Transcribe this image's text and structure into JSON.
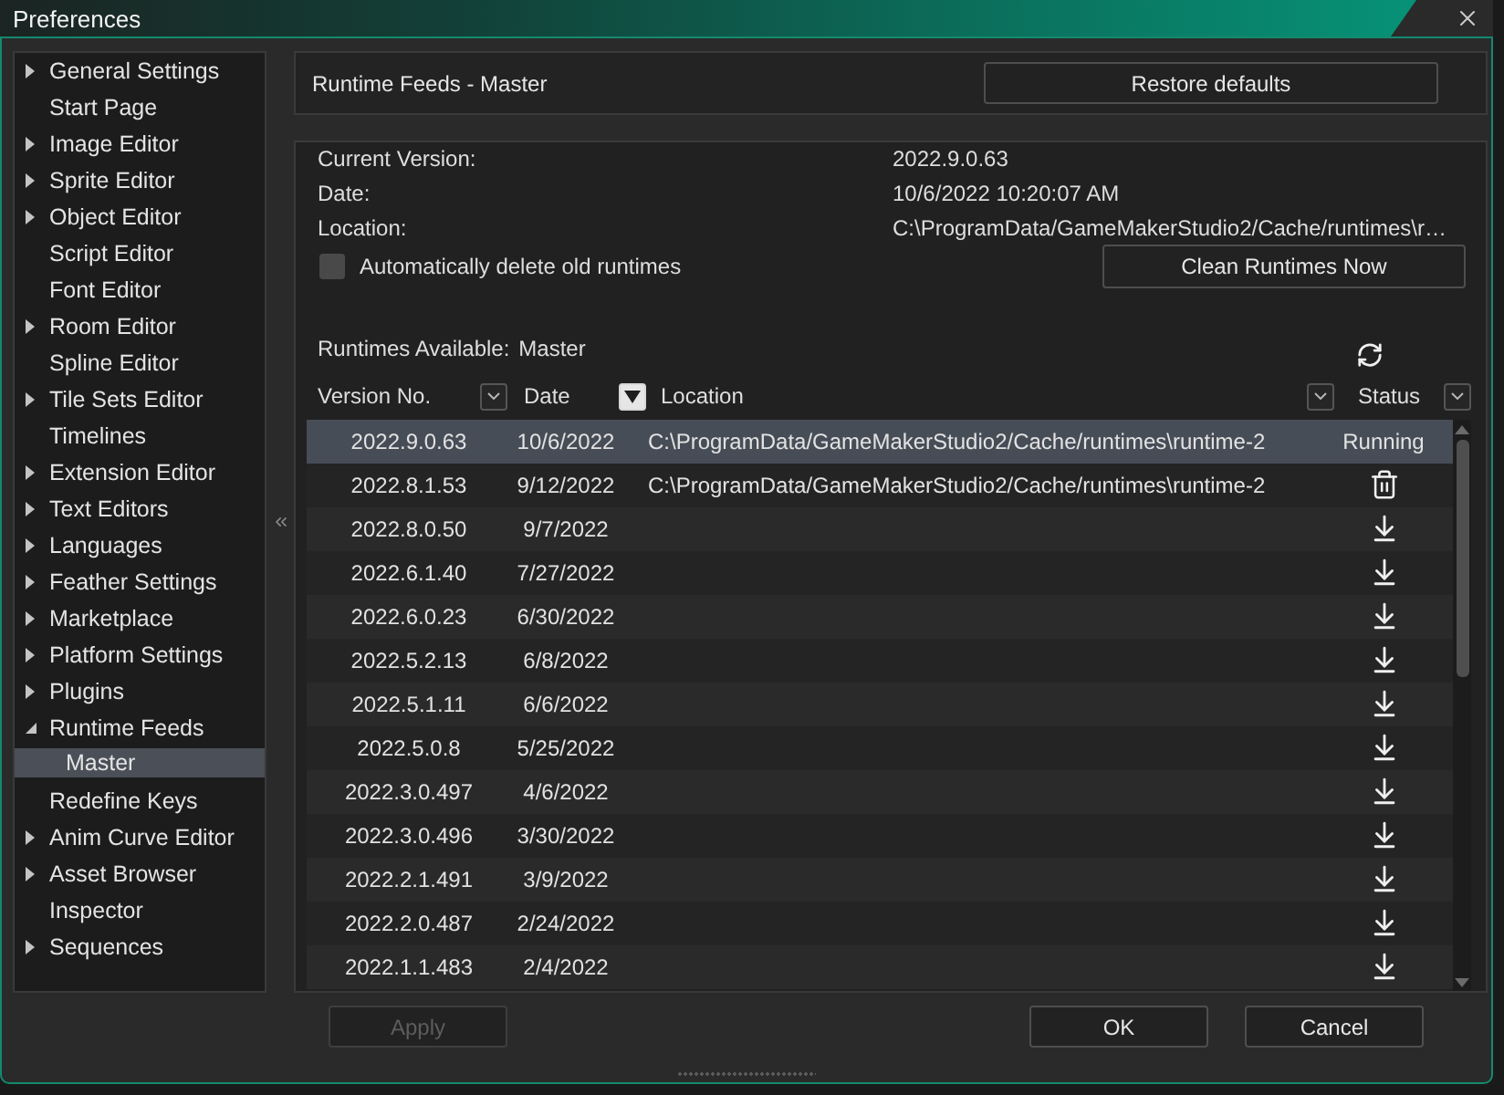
{
  "window": {
    "title": "Preferences"
  },
  "sidebar": {
    "items": [
      {
        "label": "General Settings",
        "expanded": false,
        "selected": false
      },
      {
        "label": "Start Page",
        "selected": false
      },
      {
        "label": "Image Editor",
        "expanded": false,
        "selected": false
      },
      {
        "label": "Sprite Editor",
        "expanded": false,
        "selected": false
      },
      {
        "label": "Object Editor",
        "expanded": false,
        "selected": false
      },
      {
        "label": "Script Editor",
        "selected": false
      },
      {
        "label": "Font Editor",
        "selected": false
      },
      {
        "label": "Room Editor",
        "expanded": false,
        "selected": false
      },
      {
        "label": "Spline Editor",
        "selected": false
      },
      {
        "label": "Tile Sets Editor",
        "expanded": false,
        "selected": false
      },
      {
        "label": "Timelines",
        "selected": false
      },
      {
        "label": "Extension Editor",
        "expanded": false,
        "selected": false
      },
      {
        "label": "Text Editors",
        "expanded": false,
        "selected": false
      },
      {
        "label": "Languages",
        "expanded": false,
        "selected": false
      },
      {
        "label": "Feather Settings",
        "expanded": false,
        "selected": false
      },
      {
        "label": "Marketplace",
        "expanded": false,
        "selected": false
      },
      {
        "label": "Platform Settings",
        "expanded": false,
        "selected": false
      },
      {
        "label": "Plugins",
        "expanded": false,
        "selected": false
      },
      {
        "label": "Runtime Feeds",
        "expanded": true,
        "selected": false,
        "children": [
          {
            "label": "Master",
            "selected": true
          }
        ]
      },
      {
        "label": "Redefine Keys",
        "selected": false
      },
      {
        "label": "Anim Curve Editor",
        "expanded": false,
        "selected": false
      },
      {
        "label": "Asset Browser",
        "expanded": false,
        "selected": false
      },
      {
        "label": "Inspector",
        "selected": false
      },
      {
        "label": "Sequences",
        "expanded": false,
        "selected": false
      }
    ]
  },
  "header": {
    "title": "Runtime Feeds - Master",
    "button": "Restore defaults"
  },
  "info": {
    "fields": [
      {
        "label": "Current Version:",
        "value": "2022.9.0.63"
      },
      {
        "label": "Date:",
        "value": "10/6/2022 10:20:07 AM"
      },
      {
        "label": "Location:",
        "value": "C:\\ProgramData/GameMakerStudio2/Cache/runtimes\\r…"
      }
    ],
    "auto_delete": {
      "label": "Automatically delete old runtimes",
      "checked": false
    },
    "clean_button": "Clean Runtimes Now"
  },
  "runtimes": {
    "label": "Runtimes Available:",
    "feed": "Master",
    "columns": [
      {
        "label": "Version No.",
        "sort_active": false
      },
      {
        "label": "Date",
        "sort_active": true
      },
      {
        "label": "Location",
        "sort_active": false
      },
      {
        "label": "Status",
        "sort_active": false
      }
    ],
    "rows": [
      {
        "version": "2022.9.0.63",
        "date": "10/6/2022",
        "location": "C:\\ProgramData/GameMakerStudio2/Cache/runtimes\\runtime-2",
        "kind": "running",
        "status": "Running",
        "selected": true
      },
      {
        "version": "2022.8.1.53",
        "date": "9/12/2022",
        "location": "C:\\ProgramData/GameMakerStudio2/Cache/runtimes\\runtime-2",
        "kind": "installed",
        "selected": false
      },
      {
        "version": "2022.8.0.50",
        "date": "9/7/2022",
        "kind": "available",
        "selected": false
      },
      {
        "version": "2022.6.1.40",
        "date": "7/27/2022",
        "kind": "available",
        "selected": false
      },
      {
        "version": "2022.6.0.23",
        "date": "6/30/2022",
        "kind": "available",
        "selected": false
      },
      {
        "version": "2022.5.2.13",
        "date": "6/8/2022",
        "kind": "available",
        "selected": false
      },
      {
        "version": "2022.5.1.11",
        "date": "6/6/2022",
        "kind": "available",
        "selected": false
      },
      {
        "version": "2022.5.0.8",
        "date": "5/25/2022",
        "kind": "available",
        "selected": false
      },
      {
        "version": "2022.3.0.497",
        "date": "4/6/2022",
        "kind": "available",
        "selected": false
      },
      {
        "version": "2022.3.0.496",
        "date": "3/30/2022",
        "kind": "available",
        "selected": false
      },
      {
        "version": "2022.2.1.491",
        "date": "3/9/2022",
        "kind": "available",
        "selected": false
      },
      {
        "version": "2022.2.0.487",
        "date": "2/24/2022",
        "kind": "available",
        "selected": false
      },
      {
        "version": "2022.1.1.483",
        "date": "2/4/2022",
        "kind": "available",
        "selected": false
      }
    ]
  },
  "footer": {
    "buttons": [
      {
        "label": "Apply",
        "disabled": true
      },
      {
        "label": "OK",
        "disabled": false
      },
      {
        "label": "Cancel",
        "disabled": false
      }
    ]
  }
}
